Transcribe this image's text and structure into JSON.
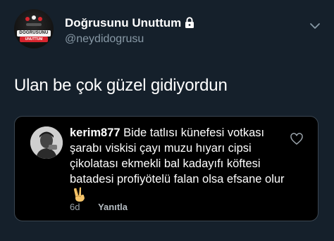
{
  "author": {
    "display_name": "Doğrusunu Unuttum",
    "handle": "@neydidogrusu",
    "avatar_logo_top": "DOĞRUSUNU",
    "avatar_logo_bottom": "UNUTTUM"
  },
  "tweet": {
    "text": "Ulan be çok güzel gidiyordun"
  },
  "quoted_reply": {
    "username": "kerim877",
    "text": "Bide tatlısı künefesi votkası şarabı viskisi çayı muzu hıyarı cipsi çikolatası ekmekli bal kadayıfı köftesi batadesi profiyötelü falan olsa efsane olur",
    "emoji": "victory-hand-icon",
    "time": "6d",
    "reply_label": "Yanıtla"
  },
  "colors": {
    "background": "#15202b",
    "quote_background": "#000000",
    "secondary_text": "#8899a6"
  }
}
